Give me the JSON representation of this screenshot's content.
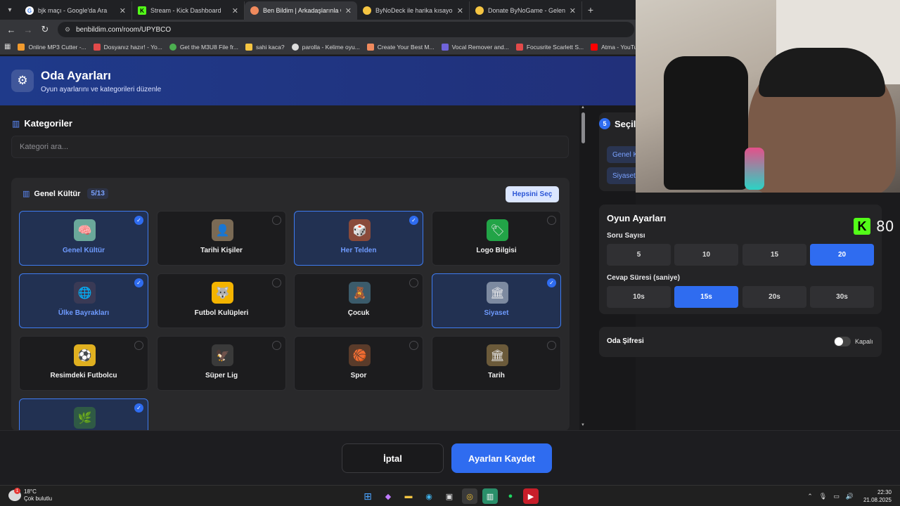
{
  "browser": {
    "tabs": [
      {
        "title": "bjk maçı - Google'da Ara",
        "icon_color": "#ffffff",
        "icon": "G"
      },
      {
        "title": "Stream - Kick Dashboard",
        "icon_color": "#53fc18",
        "icon": "K"
      },
      {
        "title": "Ben Bildim | Arkadaşlarınla Onli",
        "icon_color": "#f08a5d",
        "icon": "•"
      },
      {
        "title": "ByNoDeck ile harika kısayollar y",
        "icon_color": "#f5c542",
        "icon": "•"
      },
      {
        "title": "Donate ByNoGame - Gelen/Gid",
        "icon_color": "#f5c542",
        "icon": "•"
      }
    ],
    "url": "benbildim.com/room/UPYBCO",
    "bookmarks": [
      {
        "label": "Online MP3 Cutter -...",
        "color": "#f29b2e"
      },
      {
        "label": "Dosyanız hazır! - Yo...",
        "color": "#e24a4a"
      },
      {
        "label": "Get the M3U8 File fr...",
        "color": "#4caf50"
      },
      {
        "label": "sahi kaca?",
        "color": "#f5c542"
      },
      {
        "label": "parolla - Kelime oyu...",
        "color": "#dddddd"
      },
      {
        "label": "Create Your Best M...",
        "color": "#f08a5d"
      },
      {
        "label": "Vocal Remover and...",
        "color": "#6f63d9"
      },
      {
        "label": "Focusrite Scarlett S...",
        "color": "#e24a4a"
      },
      {
        "label": "Atma - YouTube",
        "color": "#ff0000"
      }
    ]
  },
  "header": {
    "title": "Oda Ayarları",
    "subtitle": "Oyun ayarlarını ve kategorileri düzenle"
  },
  "categories": {
    "title": "Kategoriler",
    "search_placeholder": "Kategori ara...",
    "group": {
      "name": "Genel Kültür",
      "count": "5/13",
      "select_all": "Hepsini Seç",
      "items": [
        {
          "label": "Genel Kültür",
          "selected": true,
          "icon": "🧠",
          "bg": "#6aa89a"
        },
        {
          "label": "Tarihi Kişiler",
          "selected": false,
          "icon": "👤",
          "bg": "#7a6a55"
        },
        {
          "label": "Her Telden",
          "selected": true,
          "icon": "🎲",
          "bg": "#8a4a3a"
        },
        {
          "label": "Logo Bilgisi",
          "selected": false,
          "icon": "🏷",
          "bg": "#22a447"
        },
        {
          "label": "Ülke Bayrakları",
          "selected": true,
          "icon": "🌐",
          "bg": "#3a3a55"
        },
        {
          "label": "Futbol Kulüpleri",
          "selected": false,
          "icon": "🐺",
          "bg": "#f4b400"
        },
        {
          "label": "Çocuk",
          "selected": false,
          "icon": "🧸",
          "bg": "#3b5b6b"
        },
        {
          "label": "Siyaset",
          "selected": true,
          "icon": "🏛",
          "bg": "#7d8aa0"
        },
        {
          "label": "Resimdeki Futbolcu",
          "selected": false,
          "icon": "⚽",
          "bg": "#e0b020"
        },
        {
          "label": "Süper Lig",
          "selected": false,
          "icon": "🦅",
          "bg": "#3a3a3a"
        },
        {
          "label": "Spor",
          "selected": false,
          "icon": "🏀",
          "bg": "#5a3b2a"
        },
        {
          "label": "Tarih",
          "selected": false,
          "icon": "🏛",
          "bg": "#6b5a3a"
        },
        {
          "label": "",
          "selected": true,
          "icon": "🌿",
          "bg": "#2f5a45"
        }
      ]
    }
  },
  "selected_panel": {
    "count": "5",
    "title": "Seçil",
    "chips": [
      "Genel K",
      "Siyaset"
    ]
  },
  "settings": {
    "title": "Oyun Ayarları",
    "question_count_label": "Soru Sayısı",
    "question_counts": [
      "5",
      "10",
      "15",
      "20"
    ],
    "question_count_selected": "20",
    "answer_time_label": "Cevap Süresi (saniye)",
    "answer_times": [
      "10s",
      "15s",
      "20s",
      "30s"
    ],
    "answer_time_selected": "15s"
  },
  "password": {
    "label": "Oda Şifresi",
    "state": "Kapalı"
  },
  "footer": {
    "cancel": "İptal",
    "save": "Ayarları Kaydet"
  },
  "overlay": {
    "kick_viewers": "80"
  },
  "taskbar": {
    "temperature": "18°C",
    "weather": "Çok bulutlu",
    "weather_badge": "1",
    "time": "22:30",
    "date": "21.08.2025"
  }
}
